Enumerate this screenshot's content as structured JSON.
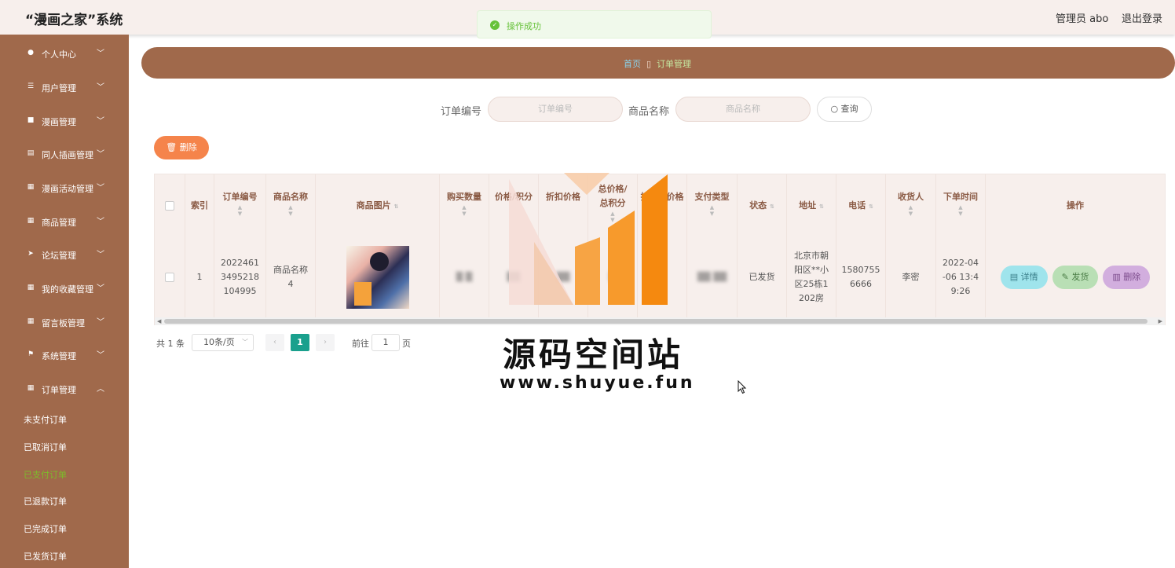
{
  "app": {
    "title": "“漫画之家”系统"
  },
  "header": {
    "admin_label": "管理员 abo",
    "logout_label": "退出登录"
  },
  "toast": {
    "text": "操作成功",
    "color": "#67c23a"
  },
  "sidebar": {
    "items": [
      {
        "label": "个人中心",
        "icon": "user-icon"
      },
      {
        "label": "用户管理",
        "icon": "sliders-icon"
      },
      {
        "label": "漫画管理",
        "icon": "book-icon"
      },
      {
        "label": "同人插画管理",
        "icon": "printer-icon"
      },
      {
        "label": "漫画活动管理",
        "icon": "grid-icon"
      },
      {
        "label": "商品管理",
        "icon": "grid-icon"
      },
      {
        "label": "论坛管理",
        "icon": "send-icon"
      },
      {
        "label": "我的收藏管理",
        "icon": "grid-icon"
      },
      {
        "label": "留言板管理",
        "icon": "grid-icon"
      },
      {
        "label": "系统管理",
        "icon": "flag-icon"
      },
      {
        "label": "订单管理",
        "icon": "grid-icon"
      }
    ],
    "sub_items": [
      "未支付订单",
      "已取消订单",
      "已支付订单",
      "已退款订单",
      "已完成订单",
      "已发货订单"
    ],
    "active_sub": "已支付订单"
  },
  "breadcrumb": {
    "home": "首页",
    "sep": "▯",
    "current": "订单管理"
  },
  "search": {
    "order_no_label": "订单编号",
    "order_no_placeholder": "订单编号",
    "product_name_label": "商品名称",
    "product_name_placeholder": "商品名称",
    "query_label": "查询"
  },
  "toolbar": {
    "delete_label": "删除"
  },
  "table": {
    "headers": [
      "索引",
      "订单编号",
      "商品名称",
      "商品图片",
      "购买数量",
      "价格/积分",
      "折扣价格",
      "总价格/总积分",
      "折扣总价格",
      "支付类型",
      "状态",
      "地址",
      "电话",
      "收货人",
      "下单时间",
      "操作"
    ],
    "row": {
      "index": "1",
      "order_no": "2022461349521810 4995",
      "order_no_lines": [
        "2022461",
        "3495218",
        "104995"
      ],
      "product_name_lines": [
        "商品名称",
        "4"
      ],
      "status": "已发货",
      "address_lines": [
        "北京市朝",
        "阳区**小",
        "区25栋1",
        "202房"
      ],
      "phone_lines": [
        "1580755",
        "6666"
      ],
      "receiver": "李密",
      "time_lines": [
        "2022-04",
        "-06 13:4",
        "9:26"
      ]
    },
    "actions": {
      "detail": "详情",
      "ship": "发货",
      "delete": "删除"
    }
  },
  "pagination": {
    "total": "共 1 条",
    "page_size": "10条/页",
    "current_page": "1",
    "goto_label": "前往",
    "goto_value": "1",
    "page_suffix": "页"
  },
  "watermark": {
    "cn": "源码空间站",
    "url": "www.shuyue.fun"
  },
  "colors": {
    "sidebar": "#a0694b",
    "header": "#f7efec",
    "accent": "#f5844b",
    "page_active": "#1aa08d"
  }
}
